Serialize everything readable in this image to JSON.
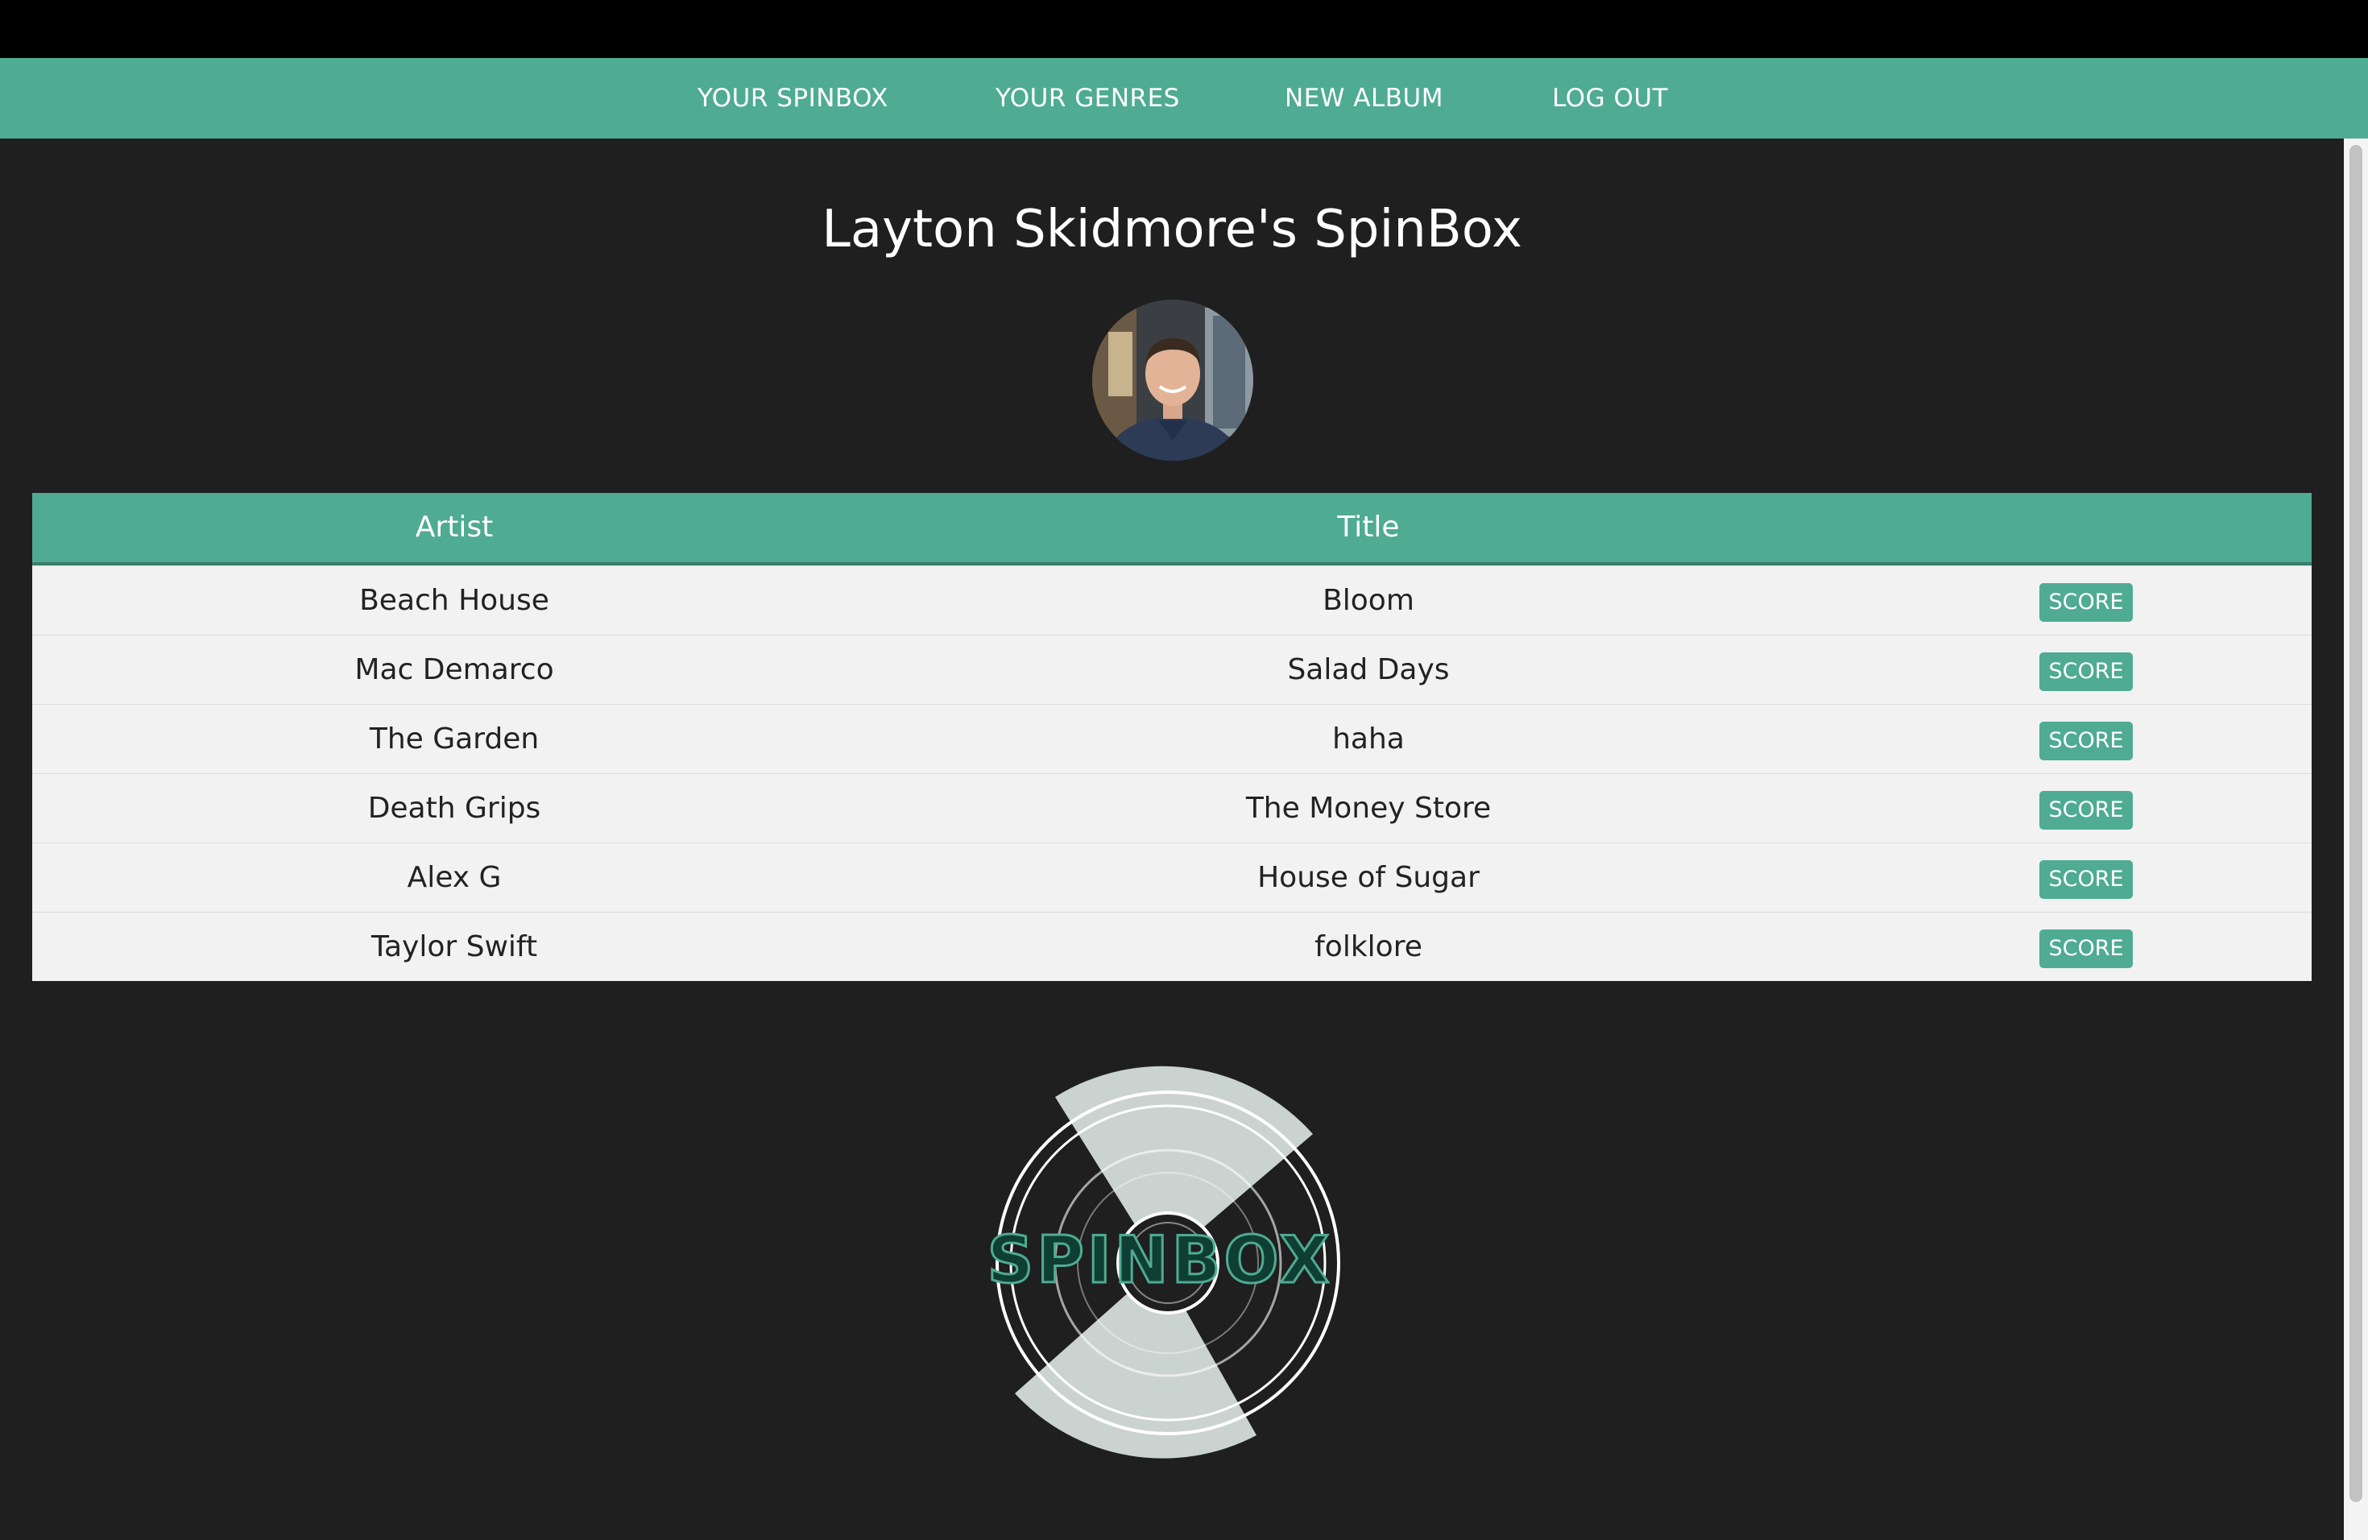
{
  "nav": {
    "items": [
      {
        "label": "YOUR SPINBOX"
      },
      {
        "label": "YOUR GENRES"
      },
      {
        "label": "NEW ALBUM"
      },
      {
        "label": "LOG OUT"
      }
    ]
  },
  "page": {
    "title": "Layton Skidmore's SpinBox"
  },
  "table": {
    "headers": {
      "artist": "Artist",
      "title": "Title"
    },
    "rows": [
      {
        "artist": "Beach House",
        "title": "Bloom",
        "action": "SCORE"
      },
      {
        "artist": "Mac Demarco",
        "title": "Salad Days",
        "action": "SCORE"
      },
      {
        "artist": "The Garden",
        "title": "haha",
        "action": "SCORE"
      },
      {
        "artist": "Death Grips",
        "title": "The Money Store",
        "action": "SCORE"
      },
      {
        "artist": "Alex G",
        "title": "House of Sugar",
        "action": "SCORE"
      },
      {
        "artist": "Taylor Swift",
        "title": "folklore",
        "action": "SCORE"
      }
    ]
  },
  "logo": {
    "text": "SPINBOX",
    "icon": "spinbox-record-logo"
  },
  "colors": {
    "accent": "#4fab92",
    "background": "#1f1f1f",
    "row_background": "#f2f2f2"
  }
}
